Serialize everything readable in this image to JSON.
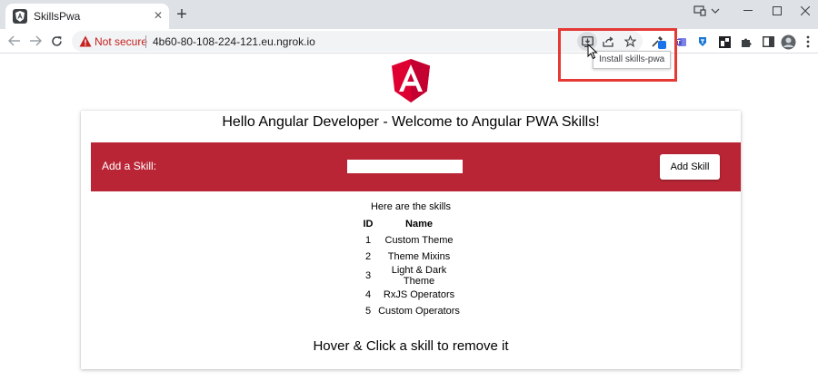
{
  "browser": {
    "tab_title": "SkillsPwa",
    "tab_close_symbol": "✕",
    "new_tab_symbol": "+",
    "security_label": "Not secure",
    "url": "4b60-80-108-224-121.eu.ngrok.io",
    "install_tooltip": "Install skills-pwa",
    "highlight_color": "#e53935"
  },
  "icons": {
    "tab_favicon": "angular-icon",
    "back": "back-arrow-icon",
    "forward": "forward-arrow-icon",
    "reload": "reload-icon",
    "install": "install-app-icon",
    "share": "share-icon",
    "bookmark": "star-icon",
    "extensions": "puzzle-icon",
    "menu": "kebab-menu-icon"
  },
  "page": {
    "card_title": "Hello Angular Developer - Welcome to Angular PWA Skills!",
    "add_label": "Add a Skill:",
    "input_value": "",
    "add_button": "Add Skill",
    "skills_heading": "Here are the skills",
    "columns": [
      "ID",
      "Name"
    ],
    "skills": [
      {
        "id": "1",
        "name": "Custom Theme"
      },
      {
        "id": "2",
        "name": "Theme Mixins"
      },
      {
        "id": "3",
        "name": "Light & Dark Theme"
      },
      {
        "id": "4",
        "name": "RxJS Operators"
      },
      {
        "id": "5",
        "name": "Custom Operators"
      }
    ],
    "footer_note": "Hover & Click a skill to remove it"
  },
  "colors": {
    "angular_red": "#dd0031",
    "add_bar": "#b92535",
    "chrome_bg": "#dee1e6",
    "warning_red": "#c5221f"
  }
}
